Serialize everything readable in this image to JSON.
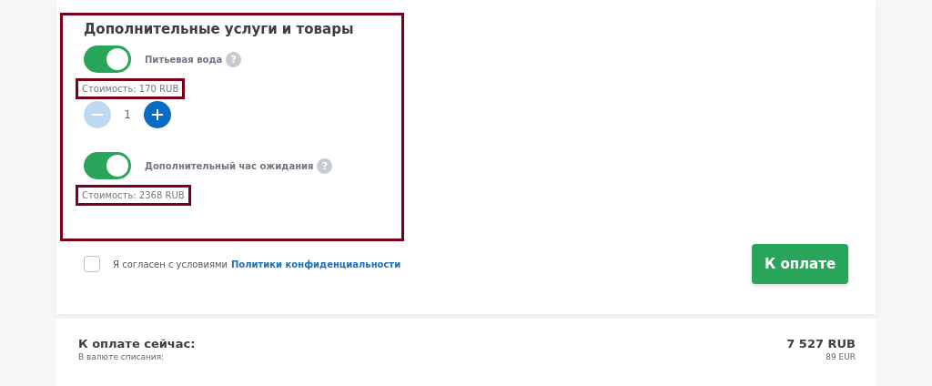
{
  "services": {
    "title": "Дополнительные услуги и товары",
    "highlighted": true,
    "items": [
      {
        "kind": "quantity",
        "label": "Питьевая вода",
        "on": true,
        "help": "?",
        "cost": "Стоимость: 170 RUB",
        "cost_highlighted": true,
        "quantity": "1",
        "minus_disabled": true,
        "plus_disabled": false
      },
      {
        "kind": "simple",
        "label": "Дополнительный час ожидания",
        "on": true,
        "help": "?",
        "cost": "Стоимость: 2368 RUB",
        "cost_highlighted": true
      }
    ]
  },
  "agreement": {
    "checked": false,
    "text": "Я согласен с условиями",
    "link": "Политики конфиденциальности"
  },
  "pay_button": "К оплате",
  "summary": {
    "label": "К оплате сейчас:",
    "sublabel": "В валюте списания:",
    "amount": "7 527 RUB",
    "amount_alt": "89 EUR"
  }
}
